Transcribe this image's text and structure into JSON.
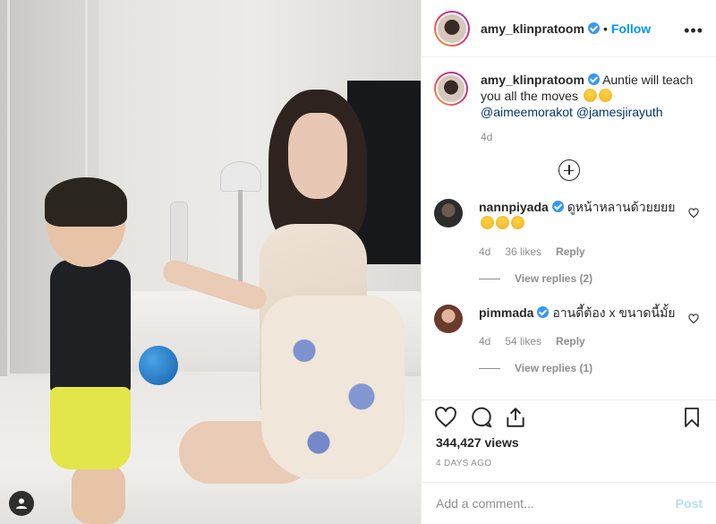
{
  "header": {
    "username": "amy_klinpratoom",
    "separator": "•",
    "follow_label": "Follow",
    "more_label": "•••"
  },
  "caption": {
    "username": "amy_klinpratoom",
    "text": "Auntie will teach you all the moves",
    "mention_1": "@aimeemorakot",
    "mention_2": "@jamesjirayuth",
    "time": "4d"
  },
  "comments": [
    {
      "username": "nannpiyada",
      "text": "ดูหน้าหลานด้วยยยย",
      "time": "4d",
      "likes": "36 likes",
      "reply_label": "Reply",
      "view_replies": "View replies (2)"
    },
    {
      "username": "pimmada",
      "text": "อานดี้ต้อง x ขนาดนี้มั้ย",
      "time": "4d",
      "likes": "54 likes",
      "reply_label": "Reply",
      "view_replies": "View replies (1)"
    }
  ],
  "stats": {
    "views": "344,427 views",
    "date": "4 DAYS AGO"
  },
  "add_comment": {
    "placeholder": "Add a comment...",
    "post_label": "Post"
  },
  "icons": {
    "like": "heart-icon",
    "comment": "comment-icon",
    "share": "share-icon",
    "save": "bookmark-icon",
    "load_more": "plus-circle-icon",
    "media_user": "user-icon"
  },
  "colors": {
    "accent": "#0095f6",
    "verified": "#3897f0",
    "muted": "#8e8e8e",
    "text": "#262626",
    "post_disabled": "#b2dffc"
  }
}
